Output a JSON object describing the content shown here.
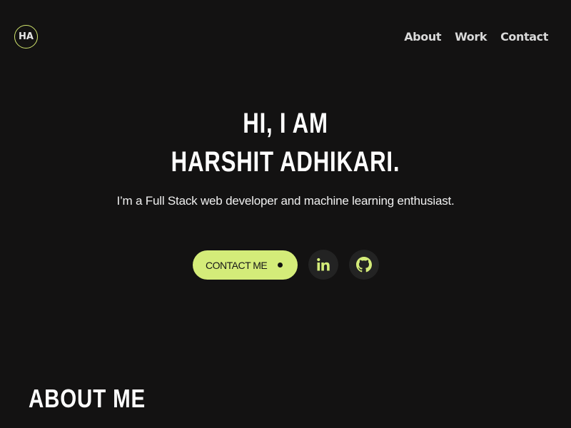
{
  "header": {
    "logo_text": "HA",
    "nav": [
      "About",
      "Work",
      "Contact"
    ]
  },
  "hero": {
    "line1": "HI, I AM",
    "line2": "HARSHIT ADHIKARI.",
    "tagline": "I’m a Full Stack web developer and machine learning enthusiast.",
    "cta_label": "CONTACT ME"
  },
  "social": [
    {
      "icon": "linkedin-icon"
    },
    {
      "icon": "github-icon"
    }
  ],
  "about": {
    "title": "ABOUT ME"
  },
  "colors": {
    "background": "#131212",
    "accent": "#d4ec79",
    "icon_bg": "#232323"
  }
}
